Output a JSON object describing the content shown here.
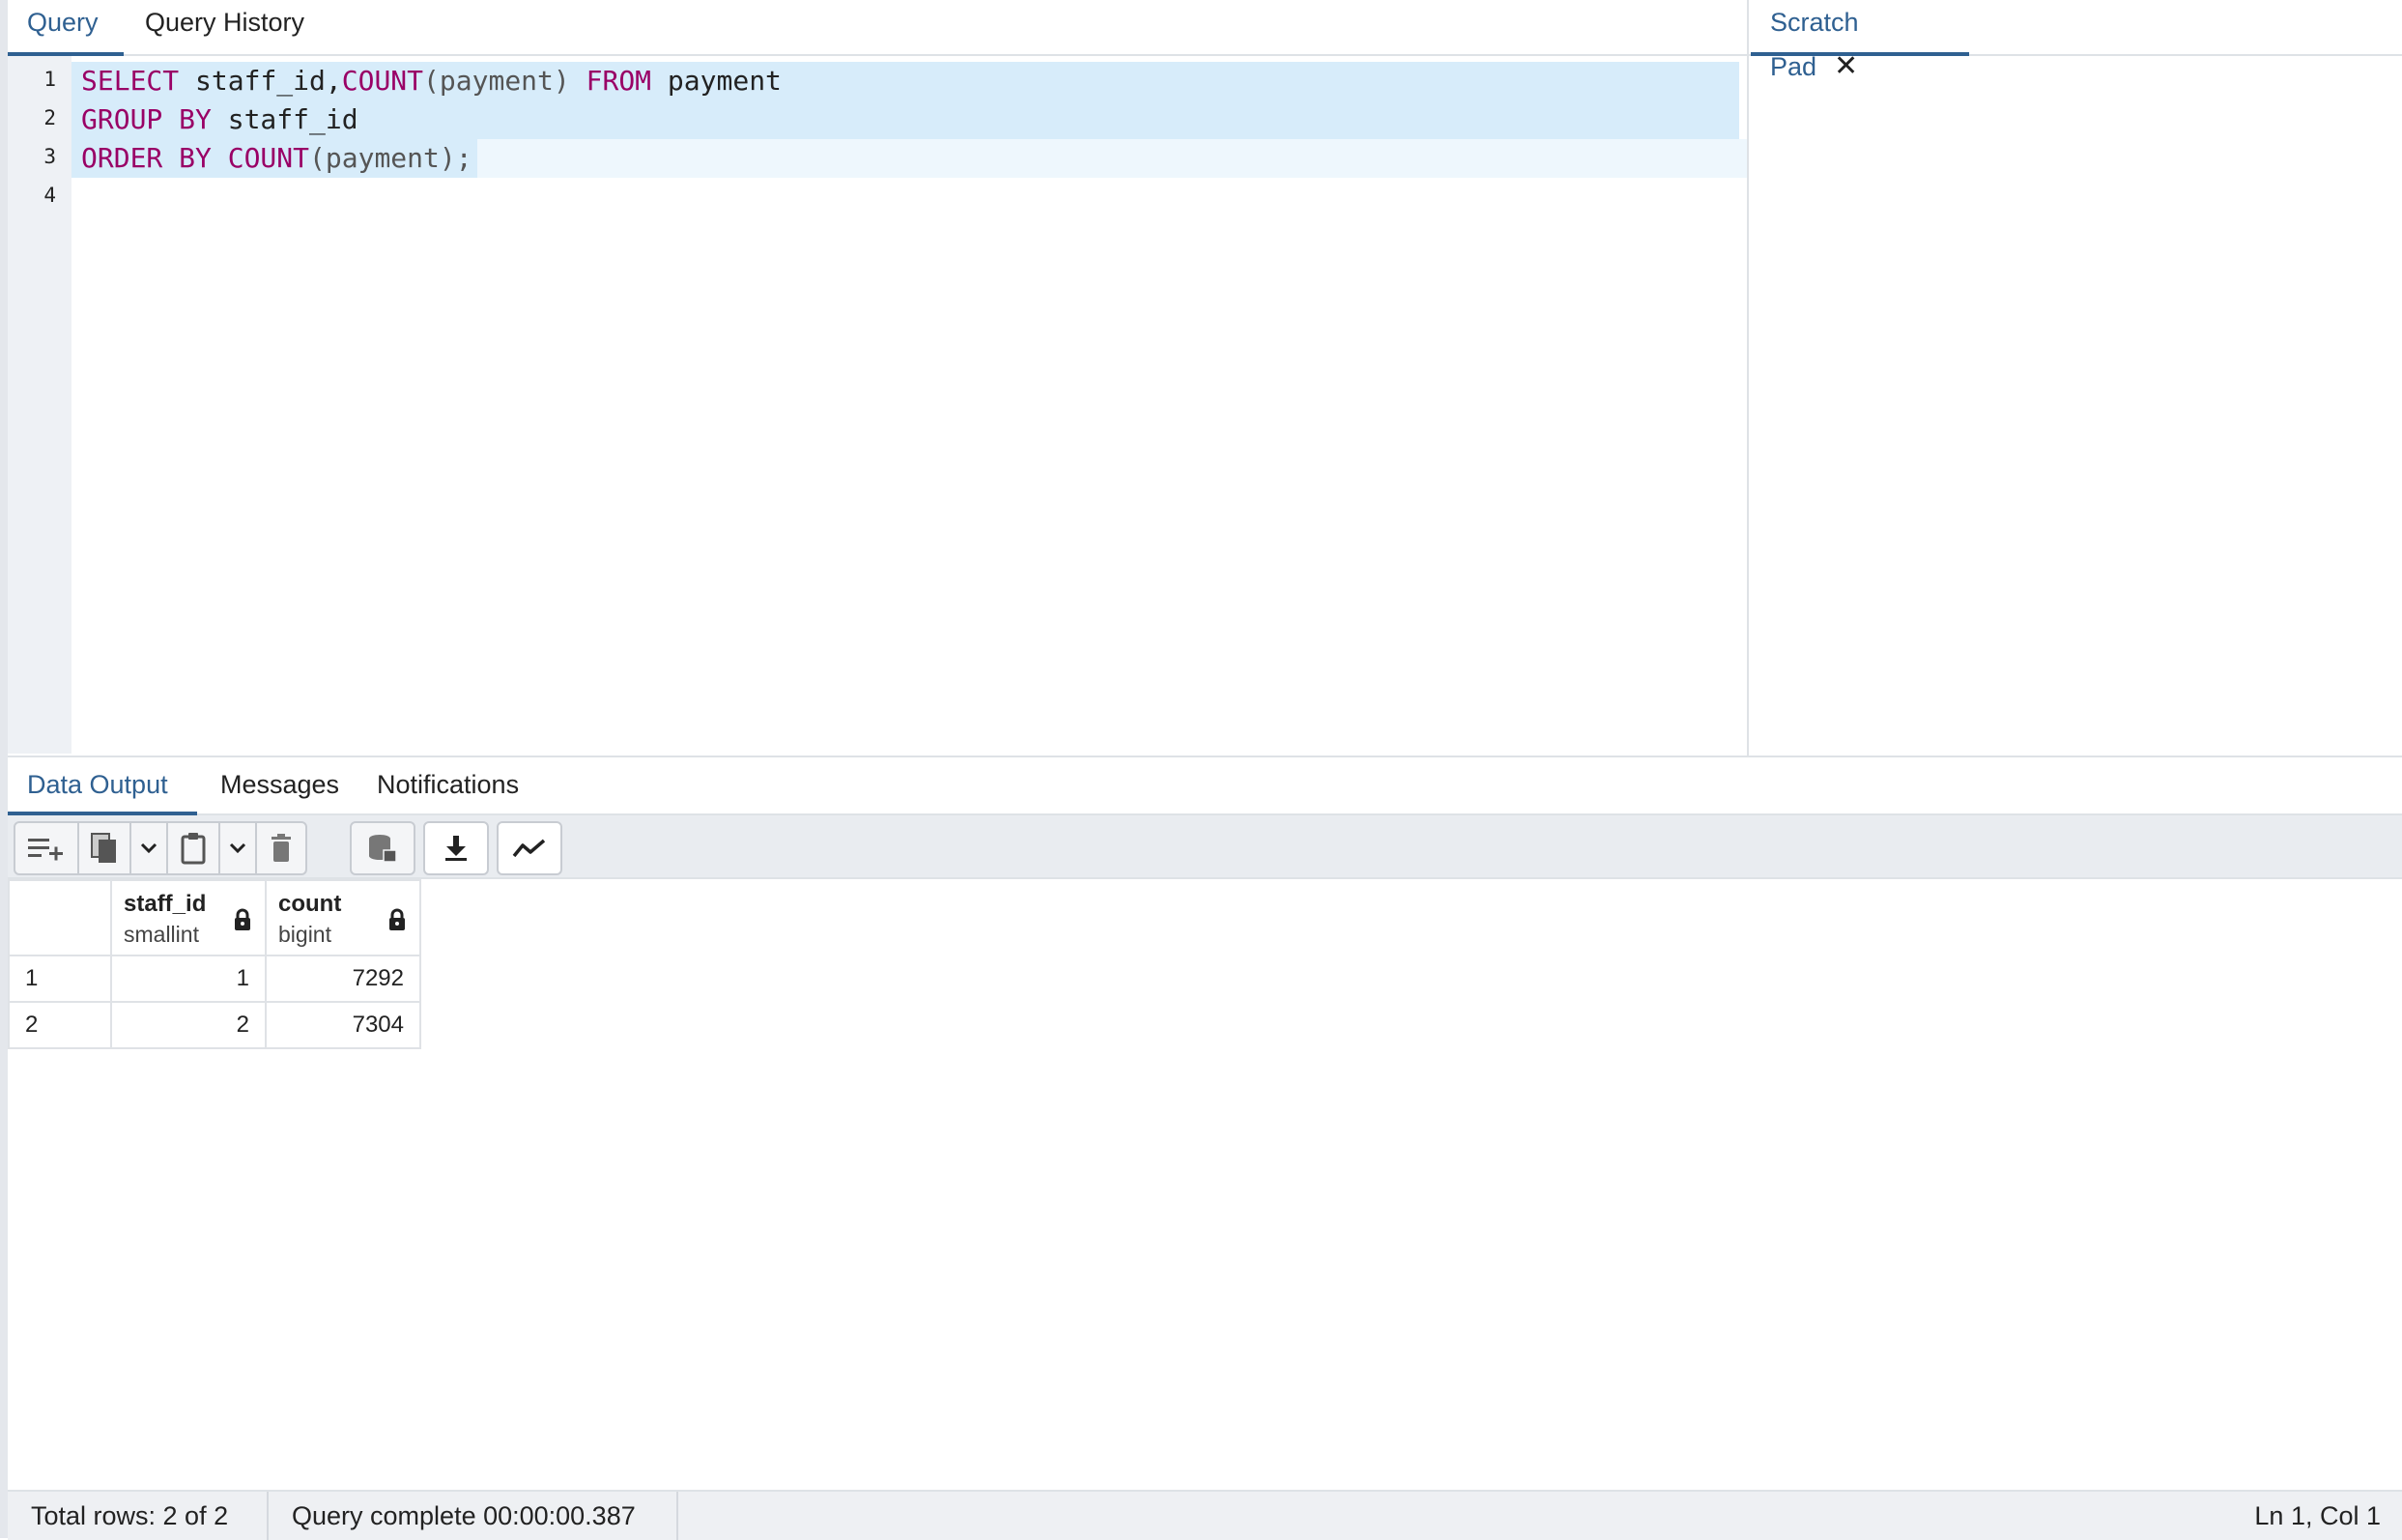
{
  "top_tabs": [
    {
      "label": "Query",
      "active": true
    },
    {
      "label": "Query History",
      "active": false
    }
  ],
  "scratch_pad": {
    "label": "Scratch Pad",
    "close_icon": "close-icon"
  },
  "editor": {
    "line_numbers": [
      "1",
      "2",
      "3",
      "4"
    ],
    "lines": [
      {
        "kw1": "SELECT",
        "t1": " staff_id,",
        "fn1": "COUNT",
        "t2": "(payment) ",
        "kw2": "FROM",
        "t3": " payment"
      },
      {
        "kw1": "GROUP BY",
        "t1": " staff_id"
      },
      {
        "kw1": "ORDER BY",
        "t1": " ",
        "fn1": "COUNT",
        "t2": "(payment);"
      }
    ]
  },
  "bottom_tabs": [
    {
      "label": "Data Output",
      "active": true
    },
    {
      "label": "Messages",
      "active": false
    },
    {
      "label": "Notifications",
      "active": false
    }
  ],
  "toolbar": {
    "icons": [
      "add-row-icon",
      "copy-icon",
      "chevron-down-icon",
      "paste-icon",
      "chevron-down-icon",
      "delete-icon",
      "save-data-icon",
      "download-icon",
      "graph-icon"
    ]
  },
  "grid": {
    "columns": [
      {
        "name": "staff_id",
        "type": "smallint",
        "locked": true
      },
      {
        "name": "count",
        "type": "bigint",
        "locked": true
      }
    ],
    "rows": [
      {
        "num": "1",
        "cells": [
          "1",
          "7292"
        ]
      },
      {
        "num": "2",
        "cells": [
          "2",
          "7304"
        ]
      }
    ]
  },
  "status": {
    "total_rows": "Total rows: 2 of 2",
    "query_complete": "Query complete 00:00:00.387",
    "cursor": "Ln 1, Col 1"
  },
  "colors": {
    "accent": "#2f6091",
    "keyword": "#990066",
    "selection": "#d7ecfa"
  }
}
